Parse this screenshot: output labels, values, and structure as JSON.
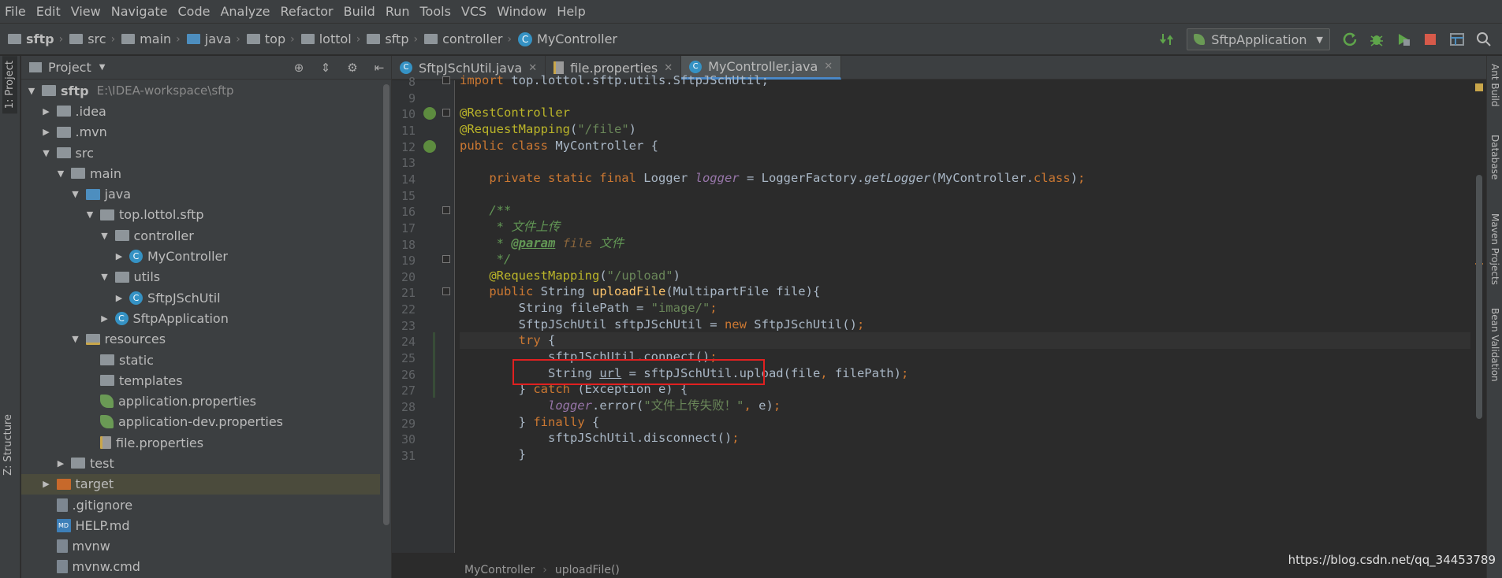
{
  "menu": [
    "File",
    "Edit",
    "View",
    "Navigate",
    "Code",
    "Analyze",
    "Refactor",
    "Build",
    "Run",
    "Tools",
    "VCS",
    "Window",
    "Help"
  ],
  "breadcrumb": [
    {
      "label": "sftp",
      "icon": "module-folder-icon"
    },
    {
      "label": "src",
      "icon": "folder-icon"
    },
    {
      "label": "main",
      "icon": "folder-icon"
    },
    {
      "label": "java",
      "icon": "source-folder-icon"
    },
    {
      "label": "top",
      "icon": "package-icon"
    },
    {
      "label": "lottol",
      "icon": "package-icon"
    },
    {
      "label": "sftp",
      "icon": "package-icon"
    },
    {
      "label": "controller",
      "icon": "package-icon"
    },
    {
      "label": "MyController",
      "icon": "class-icon"
    }
  ],
  "run_config": {
    "label": "SftpApplication"
  },
  "left_tool_tabs": {
    "project": "1: Project",
    "structure": "Z: Structure"
  },
  "project_panel": {
    "title": "Project",
    "tree": [
      {
        "label": "sftp",
        "path": "E:\\IDEA-workspace\\sftp",
        "depth": 0,
        "arrow": "▼",
        "icon": "folder",
        "bold": true
      },
      {
        "label": ".idea",
        "depth": 1,
        "arrow": "▶",
        "icon": "folder"
      },
      {
        "label": ".mvn",
        "depth": 1,
        "arrow": "▶",
        "icon": "folder"
      },
      {
        "label": "src",
        "depth": 1,
        "arrow": "▼",
        "icon": "folder"
      },
      {
        "label": "main",
        "depth": 2,
        "arrow": "▼",
        "icon": "folder"
      },
      {
        "label": "java",
        "depth": 3,
        "arrow": "▼",
        "icon": "folder-blue"
      },
      {
        "label": "top.lottol.sftp",
        "depth": 4,
        "arrow": "▼",
        "icon": "pkg"
      },
      {
        "label": "controller",
        "depth": 5,
        "arrow": "▼",
        "icon": "pkg"
      },
      {
        "label": "MyController",
        "depth": 6,
        "arrow": "▶",
        "icon": "class"
      },
      {
        "label": "utils",
        "depth": 5,
        "arrow": "▼",
        "icon": "pkg"
      },
      {
        "label": "SftpJSchUtil",
        "depth": 6,
        "arrow": "▶",
        "icon": "class"
      },
      {
        "label": "SftpApplication",
        "depth": 5,
        "arrow": "▶",
        "icon": "class"
      },
      {
        "label": "resources",
        "depth": 3,
        "arrow": "▼",
        "icon": "folder-res"
      },
      {
        "label": "static",
        "depth": 4,
        "arrow": "",
        "icon": "folder"
      },
      {
        "label": "templates",
        "depth": 4,
        "arrow": "",
        "icon": "folder"
      },
      {
        "label": "application.properties",
        "depth": 4,
        "arrow": "",
        "icon": "spring"
      },
      {
        "label": "application-dev.properties",
        "depth": 4,
        "arrow": "",
        "icon": "spring"
      },
      {
        "label": "file.properties",
        "depth": 4,
        "arrow": "",
        "icon": "props"
      },
      {
        "label": "test",
        "depth": 2,
        "arrow": "▶",
        "icon": "folder"
      },
      {
        "label": "target",
        "depth": 1,
        "arrow": "▶",
        "icon": "folder-orange",
        "selected": true
      },
      {
        "label": ".gitignore",
        "depth": 1,
        "arrow": "",
        "icon": "file"
      },
      {
        "label": "HELP.md",
        "depth": 1,
        "arrow": "",
        "icon": "md"
      },
      {
        "label": "mvnw",
        "depth": 1,
        "arrow": "",
        "icon": "file"
      },
      {
        "label": "mvnw.cmd",
        "depth": 1,
        "arrow": "",
        "icon": "file"
      }
    ]
  },
  "editor_tabs": [
    {
      "label": "SftpJSchUtil.java",
      "icon": "class",
      "active": false
    },
    {
      "label": "file.properties",
      "icon": "props",
      "active": false
    },
    {
      "label": "MyController.java",
      "icon": "class",
      "active": true
    }
  ],
  "code_lines": [
    {
      "n": "8",
      "html": "<span class='kw'>import </span>top.lottol.sftp.utils.SftpJSchUtil;"
    },
    {
      "n": "9",
      "html": ""
    },
    {
      "n": "10",
      "html": "<span class='an'>@RestController</span>"
    },
    {
      "n": "11",
      "html": "<span class='an'>@RequestMapping</span>(<span class='str'>\"/file\"</span>)"
    },
    {
      "n": "12",
      "html": "<span class='kw'>public class </span>MyController {"
    },
    {
      "n": "13",
      "html": ""
    },
    {
      "n": "14",
      "html": "    <span class='kw'>private static final </span>Logger <span class='it'>logger </span>= LoggerFactory.<span class='sf'>getLogger</span>(MyController.<span class='kw'>class</span>)<span class='kw'>;</span>"
    },
    {
      "n": "15",
      "html": ""
    },
    {
      "n": "16",
      "html": "    <span class='cm'>/**</span>"
    },
    {
      "n": "17",
      "html": "<span class='cm'>     * 文件上传</span>"
    },
    {
      "n": "18",
      "html": "<span class='cm'>     * </span><span class='tag'>@param</span><span class='prm'> file </span><span class='cm'>文件</span>"
    },
    {
      "n": "19",
      "html": "<span class='cm'>     */</span>"
    },
    {
      "n": "20",
      "html": "    <span class='an'>@RequestMapping</span>(<span class='str'>\"/upload\"</span>)"
    },
    {
      "n": "21",
      "html": "    <span class='kw'>public </span>String <span class='fn'>uploadFile</span>(MultipartFile file){"
    },
    {
      "n": "22",
      "html": "        String filePath = <span class='str'>\"image/\"</span><span class='kw'>;</span>"
    },
    {
      "n": "23",
      "html": "        SftpJSchUtil sftpJSchUtil = <span class='kw'>new </span>SftpJSchUtil()<span class='kw'>;</span>"
    },
    {
      "n": "24",
      "html": "        <span class='kw'>try </span>{",
      "caret": true
    },
    {
      "n": "25",
      "html": "            sftpJSchUtil.connect()<span class='kw'>;</span>"
    },
    {
      "n": "26",
      "html": "            String <span style='text-decoration:underline'>url</span> = sftpJSchUtil.upload(file<span class='kw'>, </span>filePath)<span class='kw'>;</span>"
    },
    {
      "n": "27",
      "html": "        } <span class='kw'>catch </span>(Exception e) {"
    },
    {
      "n": "28",
      "html": "            <span class='it'>logger</span>.error(<span class='str'>\"文件上传失败！\"</span><span class='kw'>, </span>e)<span class='kw'>;</span>"
    },
    {
      "n": "29",
      "html": "        } <span class='kw'>finally </span>{"
    },
    {
      "n": "30",
      "html": "            sftpJSchUtil.disconnect()<span class='kw'>;</span>"
    },
    {
      "n": "31",
      "html": "        }"
    }
  ],
  "right_tool_tabs": [
    "Ant Build",
    "Database",
    "Maven Projects",
    "Bean Validation"
  ],
  "bottom_breadcrumb": {
    "cls": "MyController",
    "method": "uploadFile()"
  },
  "watermark": "https://blog.csdn.net/qq_34453789"
}
